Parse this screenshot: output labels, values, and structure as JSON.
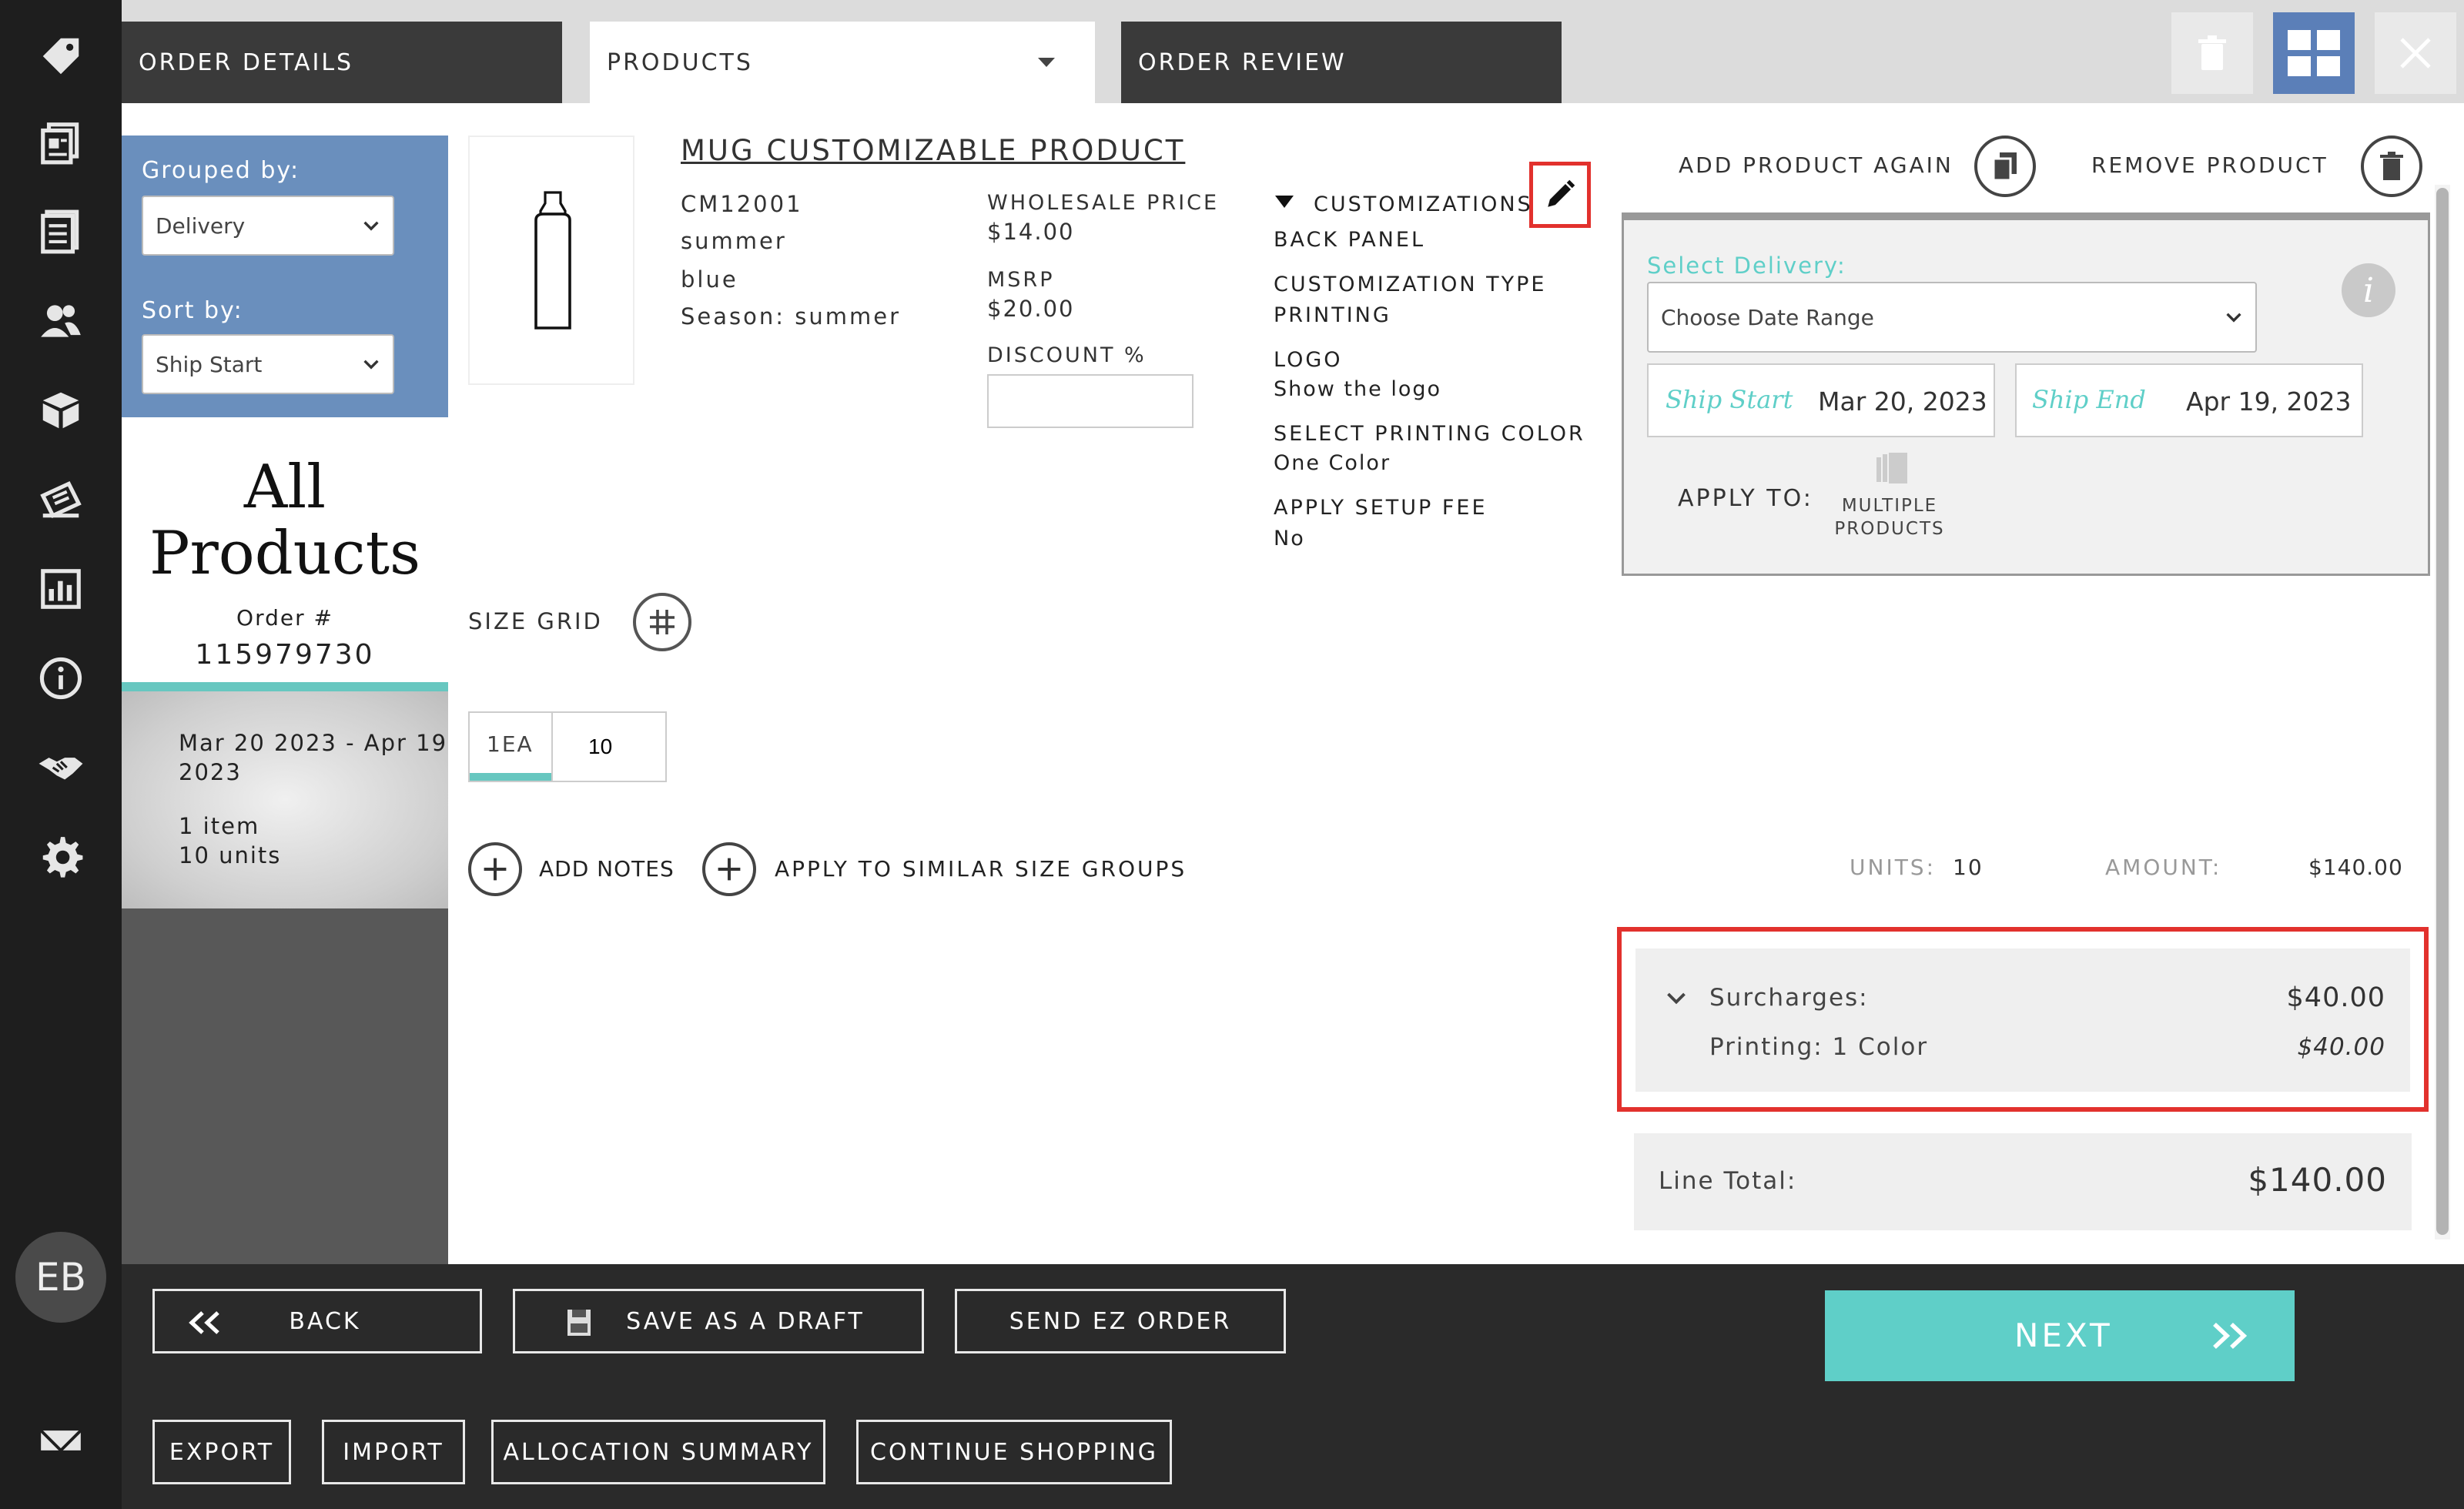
{
  "tabs": {
    "order_details": "ORDER DETAILS",
    "products": "PRODUCTS",
    "order_review": "ORDER REVIEW"
  },
  "left_panel": {
    "grouped_by_label": "Grouped by:",
    "grouped_by_value": "Delivery",
    "sort_by_label": "Sort by:",
    "sort_by_value": "Ship Start",
    "title_line1": "All",
    "title_line2": "Products",
    "order_label": "Order #",
    "order_number": "115979730",
    "delivery_range_line1": "Mar 20 2023 - Apr 19",
    "delivery_range_line2": "2023",
    "items": "1 item",
    "units": "10 units"
  },
  "product": {
    "name": "MUG CUSTOMIZABLE PRODUCT",
    "sku": "CM12001",
    "attr1": "summer",
    "attr2": "blue",
    "season": "Season: summer",
    "wholesale_label": "WHOLESALE PRICE",
    "wholesale_value": "$14.00",
    "msrp_label": "MSRP",
    "msrp_value": "$20.00",
    "discount_label": "DISCOUNT %",
    "discount_value": ""
  },
  "customizations": {
    "header": "CUSTOMIZATIONS",
    "panel": "BACK PANEL",
    "type_label": "CUSTOMIZATION TYPE",
    "type_value": "PRINTING",
    "logo_label": "LOGO",
    "logo_value": "Show the logo",
    "color_label": "SELECT PRINTING COLOR",
    "color_value": "One Color",
    "setup_label": "APPLY SETUP FEE",
    "setup_value": "No"
  },
  "size_grid": {
    "label": "SIZE GRID",
    "size": "1EA",
    "qty": "10"
  },
  "actions": {
    "add_notes": "ADD NOTES",
    "apply_similar": "APPLY TO SIMILAR SIZE GROUPS",
    "add_again": "ADD PRODUCT AGAIN",
    "remove": "REMOVE PRODUCT"
  },
  "delivery": {
    "select_label": "Select Delivery:",
    "select_value": "Choose Date Range",
    "ship_start_label": "Ship Start",
    "ship_start_value": "Mar 20, 2023",
    "ship_end_label": "Ship End",
    "ship_end_value": "Apr 19, 2023",
    "apply_to_label": "APPLY TO:",
    "multiple_line1": "MULTIPLE",
    "multiple_line2": "PRODUCTS"
  },
  "totals": {
    "units_label": "UNITS:",
    "units_value": "10",
    "amount_label": "AMOUNT:",
    "amount_value": "$140.00",
    "surcharges_label": "Surcharges:",
    "surcharges_value": "$40.00",
    "printing_label": "Printing: 1 Color",
    "printing_value": "$40.00",
    "line_total_label": "Line Total:",
    "line_total_value": "$140.00"
  },
  "footer": {
    "back": "BACK",
    "save_draft": "SAVE AS A DRAFT",
    "send_ez": "SEND EZ ORDER",
    "next": "NEXT",
    "export": "EXPORT",
    "import": "IMPORT",
    "allocation": "ALLOCATION SUMMARY",
    "continue": "CONTINUE SHOPPING"
  },
  "user": {
    "initials": "EB"
  },
  "colors": {
    "accent_teal": "#5fcfc8",
    "panel_blue": "#6a8fbd",
    "highlight_red": "#e2312d",
    "nav_dark": "#1e1e1e"
  }
}
